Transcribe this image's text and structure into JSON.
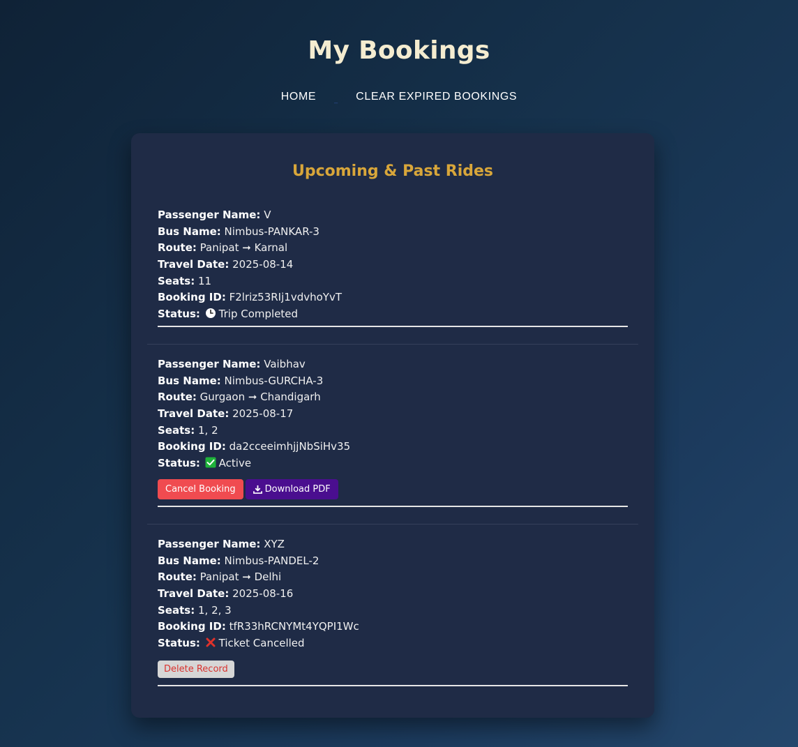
{
  "header": {
    "title": "My Bookings",
    "nav": [
      {
        "label": "HOME"
      },
      {
        "label": "CLEAR EXPIRED BOOKINGS"
      }
    ]
  },
  "card": {
    "heading": "Upcoming & Past Rides",
    "labels": {
      "passenger": "Passenger Name:",
      "bus": "Bus Name:",
      "route": "Route:",
      "date": "Travel Date:",
      "seats": "Seats:",
      "booking_id": "Booking ID:",
      "status": "Status:"
    },
    "bookings": [
      {
        "passenger": "V",
        "bus": "Nimbus-PANKAR-3",
        "route": "Panipat ➞ Karnal",
        "date": "2025-08-14",
        "seats": "11",
        "booking_id": "F2lriz53RIj1vdvhoYvT",
        "status_icon": "clock-icon",
        "status": "Trip Completed"
      },
      {
        "passenger": "Vaibhav",
        "bus": "Nimbus-GURCHA-3",
        "route": "Gurgaon ➞ Chandigarh",
        "date": "2025-08-17",
        "seats": "1, 2",
        "booking_id": "da2cceeimhjjNbSiHv35",
        "status_icon": "check-icon",
        "status": "Active",
        "actions": {
          "cancel": "Cancel Booking",
          "download": "Download PDF"
        }
      },
      {
        "passenger": "XYZ",
        "bus": "Nimbus-PANDEL-2",
        "route": "Panipat ➞ Delhi",
        "date": "2025-08-16",
        "seats": "1, 2, 3",
        "booking_id": "tfR33hRCNYMt4YQPI1Wc",
        "status_icon": "cross-icon",
        "status": "Ticket Cancelled",
        "actions": {
          "delete": "Delete Record"
        }
      }
    ]
  },
  "colors": {
    "title": "#f4ecd0",
    "heading": "#d8a63a",
    "card_bg": "#1f2b46",
    "cancel_button": "#f04b50",
    "download_button": "#4a0e8f",
    "delete_button": "#d6d6d6",
    "active_check": "#1fb33a",
    "cancelled_cross": "#e0322b"
  }
}
